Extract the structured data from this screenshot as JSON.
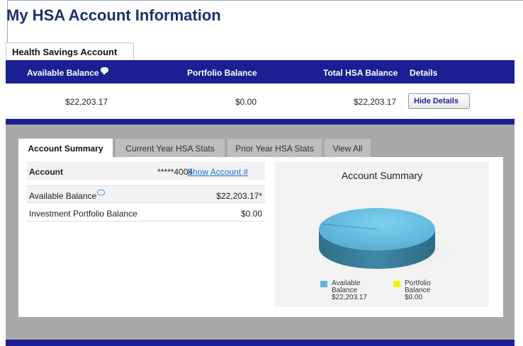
{
  "page": {
    "title": "My HSA Account Information"
  },
  "account_tab": {
    "label": "Health Savings Account"
  },
  "header": {
    "available_balance": "Available Balance",
    "portfolio_balance": "Portfolio Balance",
    "total_hsa_balance": "Total HSA Balance",
    "details": "Details"
  },
  "values": {
    "available_balance": "$22,203.17",
    "portfolio_balance": "$0.00",
    "total_hsa_balance": "$22,203.17",
    "hide_details_button": "Hide Details"
  },
  "tabs": [
    {
      "label": "Account Summary",
      "active": true
    },
    {
      "label": "Current Year HSA Stats",
      "active": false
    },
    {
      "label": "Prior Year HSA Stats",
      "active": false
    },
    {
      "label": "View All",
      "active": false
    }
  ],
  "summary": {
    "account_label": "Account",
    "account_number": "*****4004",
    "show_account_link": "Show Account #",
    "rows": [
      {
        "label": "Available Balance",
        "value": "$22,203.17*"
      },
      {
        "label": "Investment Portfolio Balance",
        "value": "$0.00"
      }
    ]
  },
  "chart": {
    "title": "Account Summary",
    "legend": [
      {
        "line1": "Available",
        "line2": "Balance",
        "line3": "$22,203.17",
        "color": "#5ab4dc"
      },
      {
        "line1": "Portfolio",
        "line2": "Balance",
        "line3": "$0.00",
        "color": "#f5f500"
      }
    ]
  },
  "chart_data": {
    "type": "pie",
    "title": "Account Summary",
    "categories": [
      "Available Balance",
      "Portfolio Balance"
    ],
    "values": [
      22203.17,
      0.0
    ],
    "colors": [
      "#5ab4dc",
      "#f5f500"
    ],
    "legend_position": "bottom"
  },
  "colors": {
    "header_blue": "#1b1f93",
    "title_blue": "#1f2f6b",
    "link_blue": "#1a6fd6",
    "panel_grey": "#a9a9a9"
  }
}
